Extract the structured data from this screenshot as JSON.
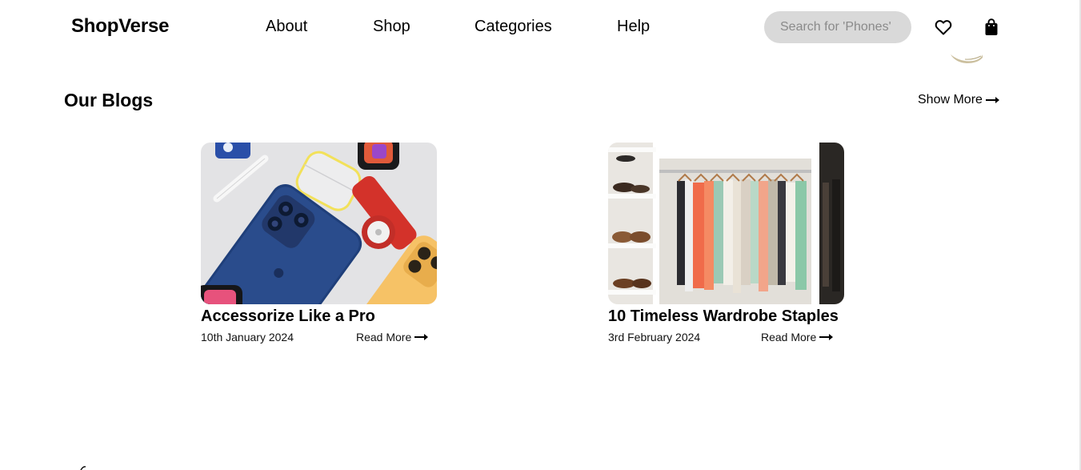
{
  "navbar": {
    "brand": "ShopVerse",
    "links": [
      {
        "label": "About"
      },
      {
        "label": "Shop"
      },
      {
        "label": "Categories"
      },
      {
        "label": "Help"
      }
    ],
    "search": {
      "placeholder": "Search for 'Phones'",
      "value": ""
    },
    "icons": [
      "heart-icon",
      "shopping-bag-icon"
    ]
  },
  "blogs": {
    "title": "Our Blogs",
    "show_more_label": "Show More",
    "posts": [
      {
        "image": "phone-accessories-photo",
        "title": "Accessorize Like a Pro",
        "date": "10th January 2024",
        "read_more_label": "Read More"
      },
      {
        "image": "wardrobe-closet-photo",
        "title": "10 Timeless Wardrobe Staples",
        "date": "3rd February 2024",
        "read_more_label": "Read More"
      }
    ]
  },
  "colors": {
    "text": "#000000",
    "search_bg": "#d9d9d9",
    "placeholder": "#8a8a8a",
    "background": "#ffffff"
  }
}
